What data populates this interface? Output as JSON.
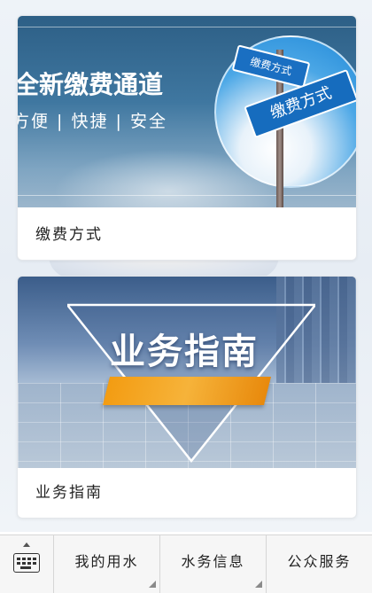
{
  "cards": [
    {
      "title": "缴费方式",
      "banner": {
        "headline": "全新缴费通道",
        "subline": "方便 | 快捷 | 安全",
        "sign_small": "缴费方式",
        "sign_large": "缴费方式"
      }
    },
    {
      "title": "业务指南",
      "banner": {
        "headline": "业务指南"
      }
    }
  ],
  "bottom_menu": {
    "keyboard_icon": "keyboard-icon",
    "items": [
      {
        "label": "我的用水",
        "has_submenu": true
      },
      {
        "label": "水务信息",
        "has_submenu": true
      },
      {
        "label": "公众服务",
        "has_submenu": false
      }
    ]
  },
  "colors": {
    "accent_blue": "#1a6fc2",
    "ribbon_orange": "#f39c12"
  }
}
